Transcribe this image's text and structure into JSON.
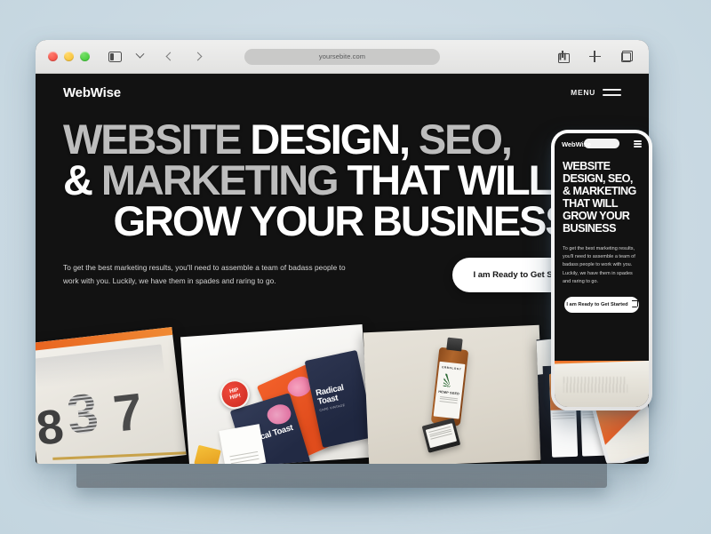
{
  "browser": {
    "url": "yoursebite.com",
    "traffic_lights": [
      "close",
      "minimize",
      "maximize"
    ],
    "icons": {
      "sidebar": "sidebar-icon",
      "sidebar_chevron": "chevron-down-icon",
      "back": "back-arrow-icon",
      "forward": "forward-arrow-icon",
      "share": "share-icon",
      "new_tab": "plus-icon",
      "tab_overview": "tab-overview-icon"
    }
  },
  "site": {
    "logo": "WebWise",
    "menu_label": "MENU",
    "headline_lines": [
      [
        {
          "text": "WEBSITE",
          "tone": "dim"
        },
        {
          "text": "DESIGN, ",
          "tone": "lit"
        },
        {
          "text": "SEO,",
          "tone": "dim"
        }
      ],
      [
        {
          "text": "& ",
          "tone": "lit"
        },
        {
          "text": "MARKETING ",
          "tone": "dim"
        },
        {
          "text": "THAT WILL",
          "tone": "lit"
        }
      ],
      [
        {
          "text": "GROW YOUR BUSINESS",
          "tone": "lit"
        }
      ]
    ],
    "headline_plain": "WEBSITE DESIGN, SEO, & MARKETING THAT WILL GROW YOUR BUSINESS",
    "paragraph": "To get the best marketing results, you'll need to assemble a team of badass people to work with you. Luckily, we have them in spades and raring to go.",
    "cta_label": "I am Ready to Get Started",
    "cta_icon": "arrow-up-right-icon"
  },
  "phone": {
    "logo": "WebWise",
    "menu_icon": "hamburger-icon",
    "headline": "WEBSITE DESIGN, SEO, & MARKETING THAT WILL GROW YOUR BUSINESS",
    "paragraph": "To get the best marketing results, you'll need to assemble a team of badass people to work with you. Luckily, we have them in spades and raring to go.",
    "cta_label": "I am Ready to Get Started",
    "cta_icon": "external-link-icon"
  },
  "gallery": {
    "tiles": [
      {
        "name": "typography-print",
        "caption_numbers": [
          "8",
          "3",
          "7"
        ]
      },
      {
        "name": "radical-toast-packaging",
        "brand": "Radical Toast",
        "subtitle": "CAFE VINTAGE",
        "badge_line1": "HIP",
        "badge_line2": "HIP!"
      },
      {
        "name": "hemp-oil-bottle",
        "brand": "ERBOLOGY",
        "product": "HEMP SEED"
      },
      {
        "name": "device-screens",
        "caption": "app screens on tablet and phone"
      }
    ]
  },
  "colors": {
    "page_background": "#cbdae3",
    "site_background": "#121212",
    "headline_dim": "#bdbdbd",
    "headline_lit": "#ffffff",
    "cta_background": "#ffffff",
    "cta_text": "#141414",
    "base_bar": "#868f96"
  }
}
